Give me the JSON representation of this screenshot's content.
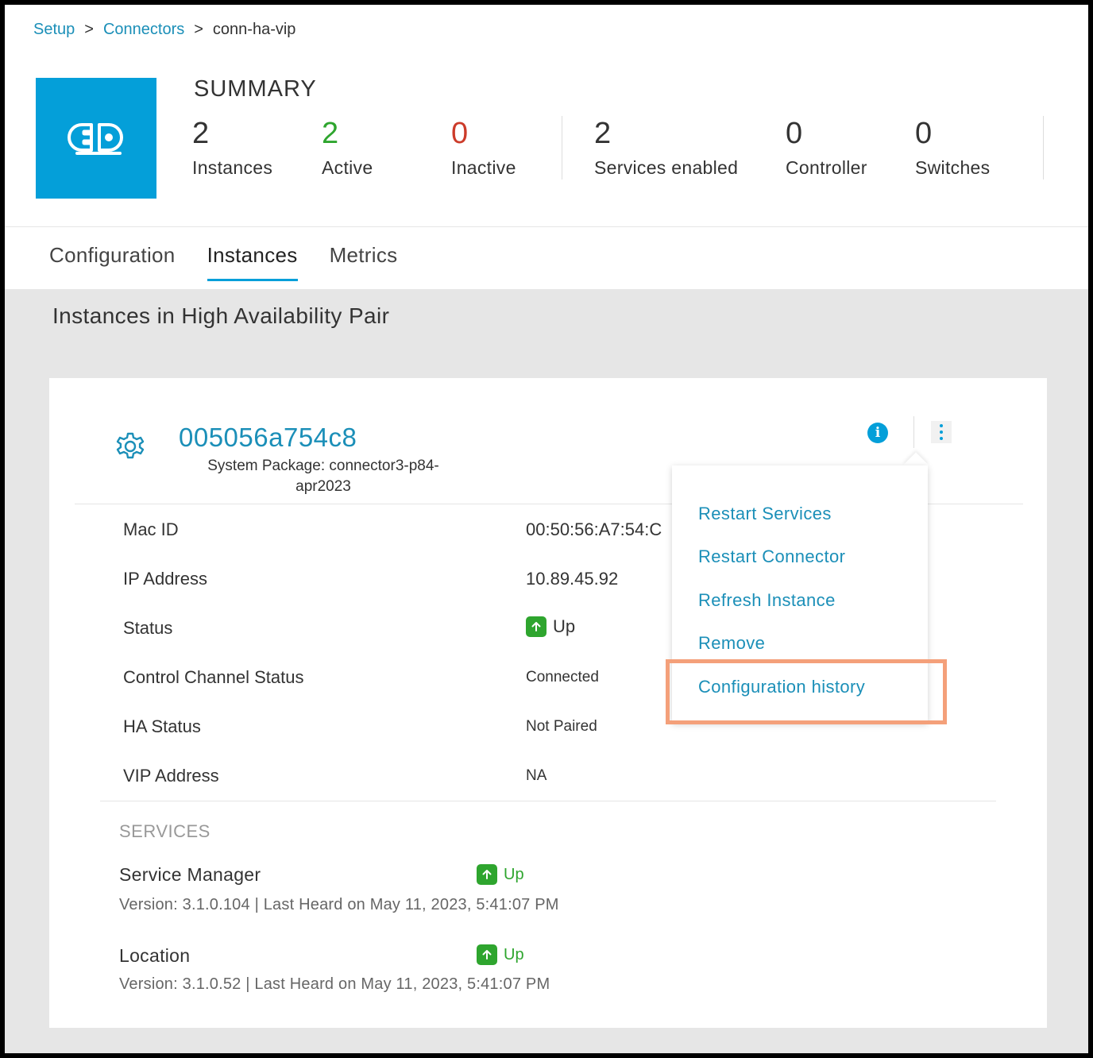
{
  "breadcrumb": {
    "items": [
      "Setup",
      "Connectors"
    ],
    "separator": ">",
    "current": "conn-ha-vip"
  },
  "summary": {
    "title": "SUMMARY",
    "icon": "plug-icon",
    "stats": [
      {
        "value": "2",
        "label": "Instances",
        "color": "#333333"
      },
      {
        "value": "2",
        "label": "Active",
        "color": "#2ea52e"
      },
      {
        "value": "0",
        "label": "Inactive",
        "color": "#cc3b2a"
      },
      {
        "value": "2",
        "label": "Services enabled",
        "color": "#333333"
      },
      {
        "value": "0",
        "label": "Controller",
        "color": "#333333"
      },
      {
        "value": "0",
        "label": "Switches",
        "color": "#333333"
      }
    ]
  },
  "tabs": [
    {
      "label": "Configuration",
      "active": false
    },
    {
      "label": "Instances",
      "active": true
    },
    {
      "label": "Metrics",
      "active": false
    }
  ],
  "section_title": "Instances in High Availability Pair",
  "instance": {
    "name": "005056a754c8",
    "package": "System Package: connector3-p84-apr2023",
    "details": [
      {
        "label": "Mac ID",
        "value": "00:50:56:A7:54:C"
      },
      {
        "label": "IP Address",
        "value": "10.89.45.92"
      },
      {
        "label": "Status",
        "value": "Up"
      },
      {
        "label": "Control Channel Status",
        "value": "Connected"
      },
      {
        "label": "HA Status",
        "value": "Not Paired"
      },
      {
        "label": "VIP Address",
        "value": "NA"
      }
    ],
    "services_title": "SERVICES",
    "services": [
      {
        "name": "Service Manager",
        "status": "Up",
        "version": "Version: 3.1.0.104 | Last Heard on May 11, 2023, 5:41:07 PM"
      },
      {
        "name": "Location",
        "status": "Up",
        "version": "Version: 3.1.0.52 | Last Heard on May 11, 2023, 5:41:07 PM"
      }
    ]
  },
  "menu": {
    "items": [
      "Restart Services",
      "Restart Connector",
      "Refresh Instance",
      "Remove",
      "Configuration history"
    ],
    "highlighted": "Configuration history"
  },
  "colors": {
    "accent": "#049fd9",
    "link": "#1b8fb8",
    "success": "#2ea52e",
    "danger": "#cc3b2a",
    "highlight": "#f4a07a"
  }
}
